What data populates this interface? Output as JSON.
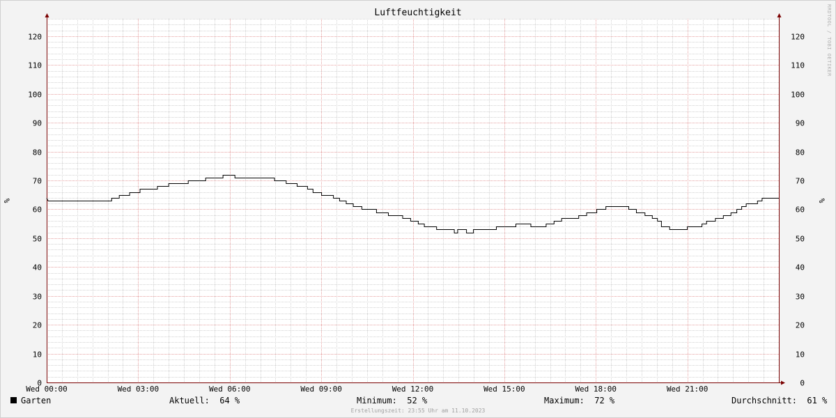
{
  "watermark": "RRDTOOL / TOBI OETIKER",
  "footer": {
    "legend_label": "Garten",
    "aktuell": "Aktuell:  64 %",
    "minimum": "Minimum:  52 %",
    "maximum": "Maximum:  72 %",
    "durchschnitt": "Durchschnitt:  61 %",
    "created": "Erstellungszeit: 23:55 Uhr am 11.10.2023"
  },
  "colors": {
    "background": "#f3f3f3",
    "plot_background": "#ffffff",
    "major_grid": "#e6a0a0",
    "minor_grid": "#d2d2d2",
    "line": "#000000",
    "axis": "#7a0000"
  },
  "chart_data": {
    "type": "line",
    "title": "Luftfeuchtigkeit",
    "ylabel": "%",
    "ylim": [
      0,
      126
    ],
    "yticks": [
      0,
      10,
      20,
      30,
      40,
      50,
      60,
      70,
      80,
      90,
      100,
      110,
      120
    ],
    "xlim_hours": [
      0,
      24
    ],
    "xticks": [
      {
        "h": 0,
        "label": "Wed 00:00"
      },
      {
        "h": 3,
        "label": "Wed 03:00"
      },
      {
        "h": 6,
        "label": "Wed 06:00"
      },
      {
        "h": 9,
        "label": "Wed 09:00"
      },
      {
        "h": 12,
        "label": "Wed 12:00"
      },
      {
        "h": 15,
        "label": "Wed 15:00"
      },
      {
        "h": 18,
        "label": "Wed 18:00"
      },
      {
        "h": 21,
        "label": "Wed 21:00"
      }
    ],
    "grid": true,
    "legend": "bottom-left",
    "series": [
      {
        "name": "Garten",
        "color": "#000000",
        "points": [
          [
            0,
            64
          ],
          [
            0.05,
            63
          ],
          [
            2.13,
            63
          ],
          [
            2.13,
            64
          ],
          [
            2.38,
            64
          ],
          [
            2.38,
            65
          ],
          [
            2.72,
            65
          ],
          [
            2.72,
            66
          ],
          [
            3.06,
            66
          ],
          [
            3.06,
            67
          ],
          [
            3.63,
            67
          ],
          [
            3.63,
            68
          ],
          [
            4.0,
            68
          ],
          [
            4.0,
            69
          ],
          [
            4.2,
            69
          ],
          [
            4.2,
            69
          ],
          [
            4.64,
            69
          ],
          [
            4.64,
            70
          ],
          [
            5.21,
            70
          ],
          [
            5.21,
            71
          ],
          [
            5.78,
            71
          ],
          [
            5.78,
            72
          ],
          [
            6.17,
            72
          ],
          [
            6.17,
            71
          ],
          [
            7.47,
            71
          ],
          [
            7.47,
            70
          ],
          [
            7.85,
            70
          ],
          [
            7.85,
            69
          ],
          [
            8.21,
            69
          ],
          [
            8.21,
            68
          ],
          [
            8.55,
            68
          ],
          [
            8.55,
            67
          ],
          [
            8.73,
            67
          ],
          [
            8.73,
            66
          ],
          [
            9.01,
            66
          ],
          [
            9.01,
            65
          ],
          [
            9.4,
            65
          ],
          [
            9.4,
            64
          ],
          [
            9.6,
            64
          ],
          [
            9.6,
            63
          ],
          [
            9.82,
            63
          ],
          [
            9.82,
            62
          ],
          [
            10.05,
            62
          ],
          [
            10.05,
            61
          ],
          [
            10.33,
            61
          ],
          [
            10.33,
            60
          ],
          [
            10.81,
            60
          ],
          [
            10.81,
            59
          ],
          [
            11.2,
            59
          ],
          [
            11.2,
            58
          ],
          [
            11.67,
            58
          ],
          [
            11.67,
            57
          ],
          [
            11.93,
            57
          ],
          [
            11.93,
            56
          ],
          [
            12.18,
            56
          ],
          [
            12.18,
            55
          ],
          [
            12.38,
            55
          ],
          [
            12.38,
            54
          ],
          [
            12.78,
            54
          ],
          [
            12.78,
            53
          ],
          [
            13.36,
            53
          ],
          [
            13.36,
            52
          ],
          [
            13.47,
            52
          ],
          [
            13.47,
            53
          ],
          [
            13.76,
            53
          ],
          [
            13.76,
            52
          ],
          [
            13.99,
            52
          ],
          [
            13.99,
            53
          ],
          [
            14.74,
            53
          ],
          [
            14.74,
            54
          ],
          [
            15.38,
            54
          ],
          [
            15.38,
            55
          ],
          [
            15.87,
            55
          ],
          [
            15.87,
            54
          ],
          [
            16.37,
            54
          ],
          [
            16.37,
            55
          ],
          [
            16.63,
            55
          ],
          [
            16.63,
            56
          ],
          [
            16.88,
            56
          ],
          [
            16.88,
            57
          ],
          [
            17.44,
            57
          ],
          [
            17.44,
            58
          ],
          [
            17.7,
            58
          ],
          [
            17.7,
            59
          ],
          [
            18.03,
            59
          ],
          [
            18.03,
            60
          ],
          [
            18.33,
            60
          ],
          [
            18.33,
            61
          ],
          [
            19.08,
            61
          ],
          [
            19.08,
            60
          ],
          [
            19.33,
            60
          ],
          [
            19.33,
            59
          ],
          [
            19.61,
            59
          ],
          [
            19.61,
            58
          ],
          [
            19.85,
            58
          ],
          [
            19.85,
            57
          ],
          [
            20.02,
            57
          ],
          [
            20.02,
            56
          ],
          [
            20.15,
            56
          ],
          [
            20.15,
            54
          ],
          [
            20.42,
            54
          ],
          [
            20.42,
            53
          ],
          [
            21.0,
            53
          ],
          [
            21.0,
            54
          ],
          [
            21.48,
            54
          ],
          [
            21.48,
            55
          ],
          [
            21.63,
            55
          ],
          [
            21.63,
            56
          ],
          [
            21.92,
            56
          ],
          [
            21.92,
            57
          ],
          [
            22.18,
            57
          ],
          [
            22.18,
            58
          ],
          [
            22.43,
            58
          ],
          [
            22.43,
            59
          ],
          [
            22.62,
            59
          ],
          [
            22.62,
            60
          ],
          [
            22.78,
            60
          ],
          [
            22.78,
            61
          ],
          [
            22.93,
            61
          ],
          [
            22.93,
            62
          ],
          [
            23.3,
            62
          ],
          [
            23.3,
            63
          ],
          [
            23.45,
            63
          ],
          [
            23.45,
            64
          ],
          [
            23.5,
            64
          ],
          [
            23.5,
            64
          ],
          [
            24,
            64
          ]
        ]
      }
    ]
  }
}
